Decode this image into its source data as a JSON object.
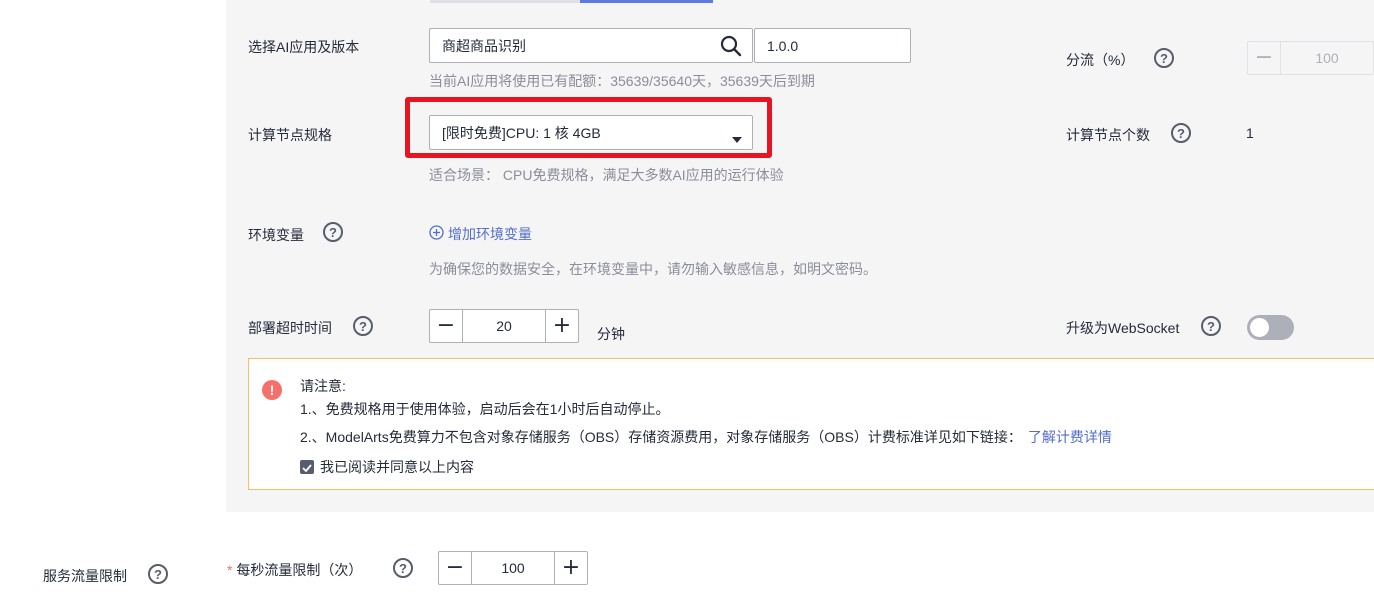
{
  "app_version_row": {
    "label": "选择AI应用及版本",
    "app_value": "商超商品识别",
    "version_value": "1.0.0",
    "hint": "当前AI应用将使用已有配额：35639/35640天，35639天后到期"
  },
  "traffic_split": {
    "label": "分流（%）",
    "value": "100"
  },
  "node_spec": {
    "label": "计算节点规格",
    "selected": "[限时免费]CPU: 1 核 4GB",
    "hint": "适合场景： CPU免费规格，满足大多数AI应用的运行体验"
  },
  "node_count": {
    "label": "计算节点个数",
    "value": "1"
  },
  "env_vars": {
    "label": "环境变量",
    "add_label": "增加环境变量",
    "hint": "为确保您的数据安全，在环境变量中，请勿输入敏感信息，如明文密码。"
  },
  "deploy_timeout": {
    "label": "部署超时时间",
    "value": "20",
    "unit": "分钟"
  },
  "websocket": {
    "label": "升级为WebSocket",
    "enabled": false
  },
  "notice": {
    "title": "请注意:",
    "line1": "1.、免费规格用于使用体验，启动后会在1小时后自动停止。",
    "line2": "2.、ModelArts免费算力不包含对象存储服务（OBS）存储资源费用，对象存储服务（OBS）计费标准详见如下链接：",
    "link": "了解计费详情",
    "agree_label": "我已阅读并同意以上内容"
  },
  "traffic_limit": {
    "section_label": "服务流量限制",
    "star": "*",
    "field_label": "每秒流量限制（次）",
    "value": "100"
  },
  "icons": {
    "help": "?",
    "minus": "−",
    "plus": "+",
    "check": "✓",
    "alert": "!"
  },
  "colors": {
    "highlight": "#e8141f",
    "link": "#526ecc",
    "warning_border": "#f3c16c",
    "alert": "#f66f6a"
  }
}
